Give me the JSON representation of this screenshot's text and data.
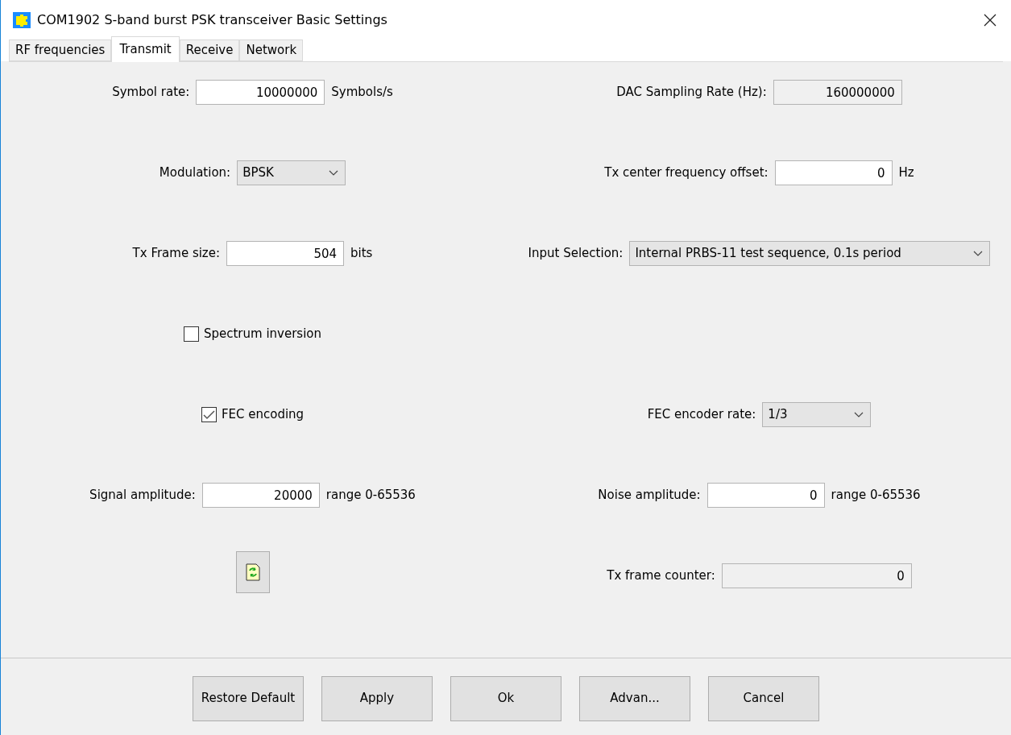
{
  "window": {
    "title": "COM1902 S-band burst PSK transceiver Basic Settings"
  },
  "tabs": [
    {
      "label": "RF frequencies",
      "selected": false
    },
    {
      "label": "Transmit",
      "selected": true
    },
    {
      "label": "Receive",
      "selected": false
    },
    {
      "label": "Network",
      "selected": false
    }
  ],
  "rows": [
    {
      "left": {
        "kind": "text",
        "label": "Symbol rate:",
        "value": "10000000",
        "unit": "Symbols/s"
      },
      "right": {
        "kind": "readonly",
        "label": "DAC Sampling Rate (Hz):",
        "value": "160000000"
      }
    },
    {
      "left": {
        "kind": "select",
        "label": "Modulation:",
        "value": "BPSK"
      },
      "right": {
        "kind": "text",
        "label": "Tx center frequency offset:",
        "value": "0",
        "unit": "Hz"
      }
    },
    {
      "left": {
        "kind": "text",
        "label": "Tx Frame size:",
        "value": "504",
        "unit": "bits"
      },
      "right": {
        "kind": "select",
        "label": "Input Selection:",
        "value": "Internal PRBS-11 test sequence, 0.1s period"
      }
    },
    {
      "left": {
        "kind": "checkbox",
        "label": "Spectrum inversion",
        "checked": false
      }
    },
    {
      "left": {
        "kind": "checkbox",
        "label": "FEC encoding",
        "checked": true
      },
      "right": {
        "kind": "select",
        "label": "FEC encoder rate:",
        "value": "1/3"
      }
    },
    {
      "left": {
        "kind": "text",
        "label": "Signal amplitude:",
        "value": "20000",
        "unit": "range 0-65536"
      },
      "right": {
        "kind": "text",
        "label": "Noise amplitude:",
        "value": "0",
        "unit": "range 0-65536"
      }
    },
    {
      "left": {
        "kind": "icon_button"
      },
      "right": {
        "kind": "readonly",
        "label": "Tx frame counter:",
        "value": "0"
      }
    }
  ],
  "buttons": [
    "Restore Default",
    "Apply",
    "Ok",
    "Advan...",
    "Cancel"
  ]
}
